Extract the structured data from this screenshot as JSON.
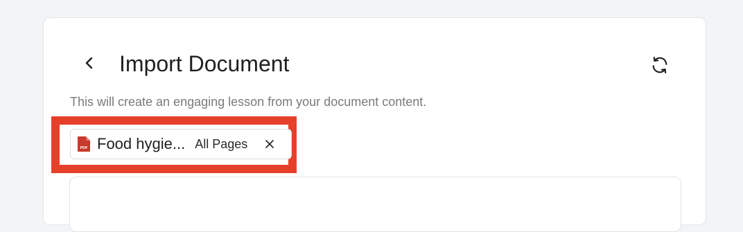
{
  "header": {
    "title": "Import Document",
    "back_icon": "chevron-left-icon",
    "refresh_icon": "refresh-icon"
  },
  "description": "This will create an engaging lesson from your document content.",
  "attachment": {
    "file_icon": "pdf-file-icon",
    "file_type_label": "PDF",
    "file_name": "Food hygie...",
    "page_scope": "All Pages",
    "remove_icon": "close-icon"
  },
  "colors": {
    "highlight": "#e6402a",
    "pdf_icon": "#c7392b"
  }
}
